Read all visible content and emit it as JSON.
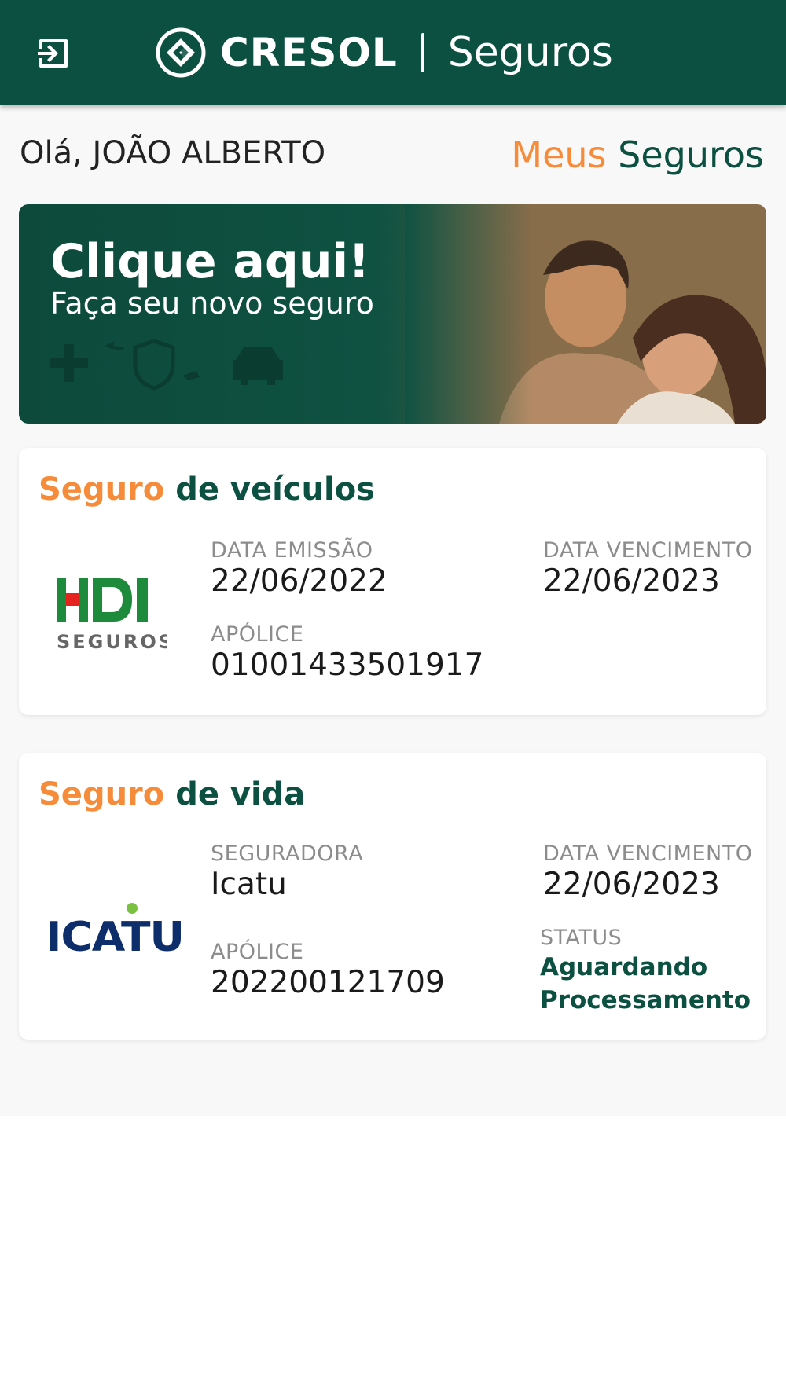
{
  "header": {
    "brand_name": "CRESOL",
    "brand_sub": "Seguros",
    "logout_icon": "logout-icon",
    "bg_color": "#0b5040"
  },
  "greeting": {
    "text": "Olá, JOÃO ALBERTO",
    "my_insurance_word1": "Meus",
    "my_insurance_word2": "Seguros"
  },
  "banner": {
    "title": "Clique aqui!",
    "subtitle": "Faça seu novo seguro"
  },
  "cards": {
    "vehicle": {
      "title_part1": "Seguro",
      "title_part2": "de veículos",
      "insurer_logo_text": "HDI",
      "insurer_logo_sub": "SEGUROS",
      "issue_label": "DATA EMISSÃO",
      "issue_value": "22/06/2022",
      "due_label": "DATA VENCIMENTO",
      "due_value": "22/06/2023",
      "policy_label": "APÓLICE",
      "policy_value": "01001433501917"
    },
    "life": {
      "title_part1": "Seguro",
      "title_part2": "de vida",
      "insurer_logo_text": "ICATU",
      "insurer_label": "SEGURADORA",
      "insurer_value": "Icatu",
      "due_label": "DATA VENCIMENTO",
      "due_value": "22/06/2023",
      "policy_label": "APÓLICE",
      "policy_value": "202200121709",
      "status_label": "STATUS",
      "status_line1": "Aguardando",
      "status_line2": "Processamento"
    }
  },
  "colors": {
    "brand_green": "#0b5040",
    "accent_orange": "#f68b3a",
    "hdi_green": "#1d8a3c",
    "hdi_red": "#e52420",
    "icatu_blue": "#0e2d6b",
    "icatu_dot": "#7ac142"
  }
}
